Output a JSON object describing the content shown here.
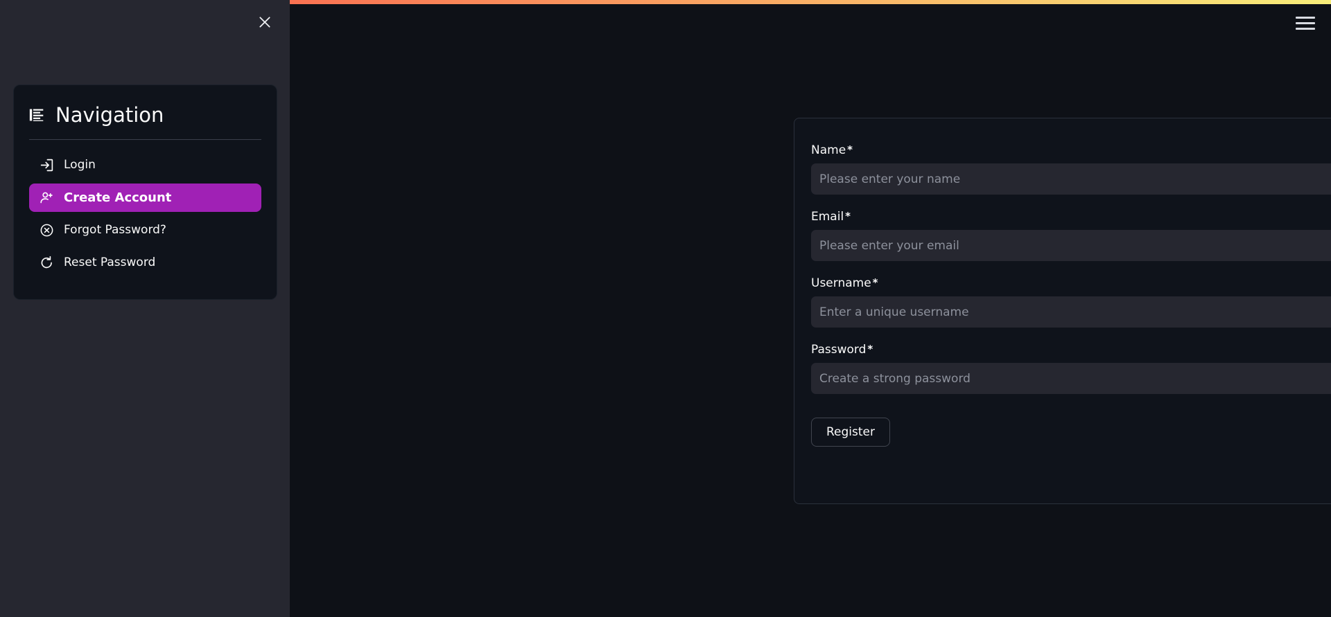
{
  "theme": {
    "page_bg": "#0e1117",
    "drawer_bg": "#262730",
    "card_bg": "#0f131b",
    "input_bg": "#262730",
    "accent_purple": "#a021b5",
    "accent_bar_from": "#fa7252",
    "accent_bar_to": "#f8ee7a",
    "text_primary": "#fafafa",
    "placeholder": "#8d919c"
  },
  "topbar": {
    "menu_icon": "hamburger-icon",
    "accent_bar_name": "gradient-accent-bar"
  },
  "drawer": {
    "close_icon": "close-icon",
    "title": "Navigation",
    "title_icon": "list-menu-icon",
    "items": [
      {
        "label": "Login",
        "icon": "login-arrow-icon",
        "active": false
      },
      {
        "label": "Create Account",
        "icon": "person-add-icon",
        "active": true
      },
      {
        "label": "Forgot Password?",
        "icon": "x-circle-icon",
        "active": false
      },
      {
        "label": "Reset Password",
        "icon": "rotate-ccw-icon",
        "active": false
      }
    ]
  },
  "form": {
    "fields": [
      {
        "label": "Name",
        "required_marker": "*",
        "placeholder": "Please enter your name",
        "value": "",
        "type": "text",
        "name": "name"
      },
      {
        "label": "Email",
        "required_marker": "*",
        "placeholder": "Please enter your email",
        "value": "",
        "type": "text",
        "name": "email"
      },
      {
        "label": "Username",
        "required_marker": "*",
        "placeholder": "Enter a unique username",
        "value": "",
        "type": "text",
        "name": "username"
      },
      {
        "label": "Password",
        "required_marker": "*",
        "placeholder": "Create a strong password",
        "value": "",
        "type": "password",
        "name": "password",
        "toggle_icon": "eye-icon"
      }
    ],
    "submit_label": "Register"
  }
}
